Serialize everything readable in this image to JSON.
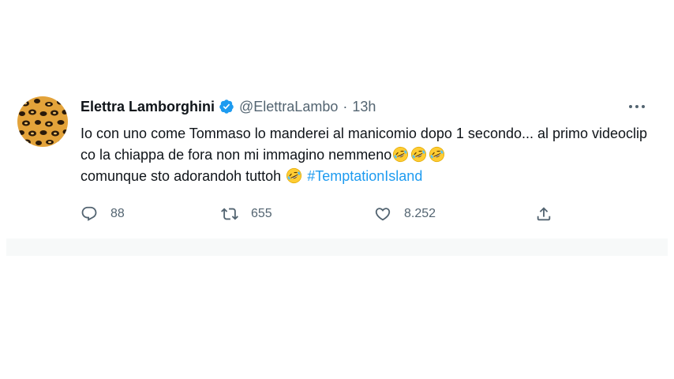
{
  "tweet": {
    "author_name": "Elettra Lamborghini",
    "handle": "@ElettraLambo",
    "separator": "·",
    "time": "13h",
    "text_part1": "Io con uno come Tommaso lo manderei al manicomio dopo 1 secondo... al primo videoclip co la chiappa de fora non mi immagino nemmeno",
    "text_part2": "comunque sto adorandoh tuttoh",
    "hashtag": "#TemptationIsland",
    "emoji": "rolling-on-the-floor-laughing",
    "verified_color": "#1d9bf0",
    "hashtag_color": "#1d9bf0"
  },
  "actions": {
    "reply_count": "88",
    "retweet_count": "655",
    "like_count": "8.252"
  },
  "icons": {
    "reply": "comment-icon",
    "retweet": "retweet-icon",
    "like": "heart-icon",
    "share": "share-icon",
    "more": "more-icon"
  }
}
